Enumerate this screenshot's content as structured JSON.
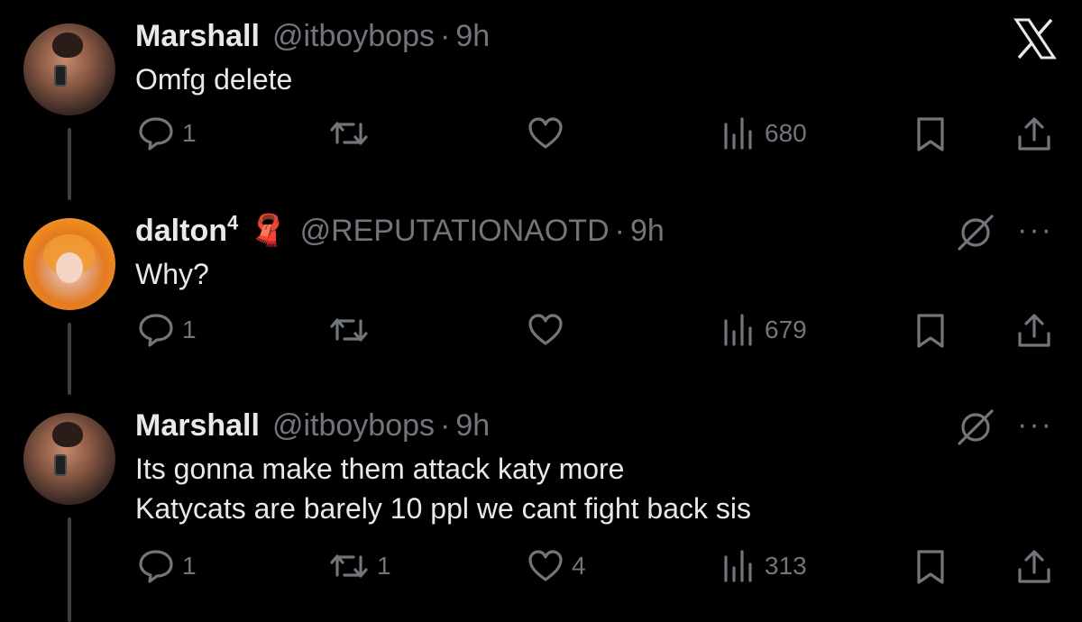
{
  "app_icon": "x-logo",
  "tweets": [
    {
      "name": "Marshall",
      "handle": "@itboybops",
      "dot": "·",
      "time": "9h",
      "lines": [
        "Omfg delete"
      ],
      "replies": "1",
      "reposts": "",
      "likes": "",
      "views": "680"
    },
    {
      "name": "dalton",
      "name_sup": "4",
      "emoji": "🧣",
      "handle": "@REPUTATIONAOTD",
      "dot": "·",
      "time": "9h",
      "lines": [
        "Why?"
      ],
      "replies": "1",
      "reposts": "",
      "likes": "",
      "views": "679"
    },
    {
      "name": "Marshall",
      "handle": "@itboybops",
      "dot": "·",
      "time": "9h",
      "lines": [
        "Its gonna make them attack katy more",
        "Katycats are barely 10 ppl we cant fight back sis"
      ],
      "replies": "1",
      "reposts": "1",
      "likes": "4",
      "views": "313"
    }
  ],
  "more_label": "···",
  "colors": {
    "background": "#000000",
    "text": "#e7e9ea",
    "muted": "#71767b",
    "line": "#3e4144"
  }
}
